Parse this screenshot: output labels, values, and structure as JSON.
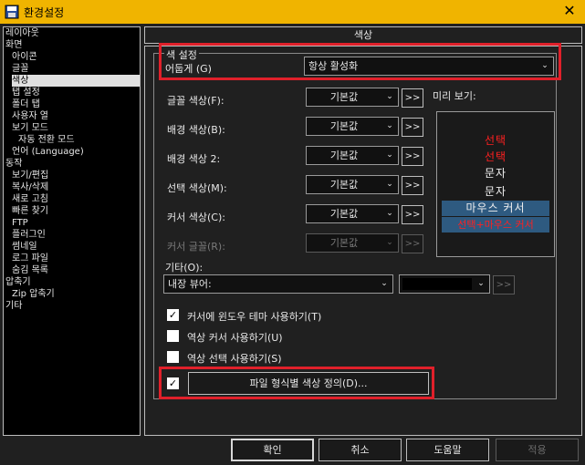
{
  "window": {
    "title": "환경설정",
    "close_glyph": "✕"
  },
  "tree": {
    "items": [
      "레이아웃",
      "화면",
      "아이콘",
      "글꼴",
      "색상",
      "탭 설정",
      "폴더 탭",
      "사용자 열",
      "보기 모드",
      "자동 전환 모드",
      "언어 (Language)",
      "동작",
      "보기/편집",
      "복사/삭제",
      "새로 고침",
      "빠른 찾기",
      "FTP",
      "플러그인",
      "썸네일",
      "로그 파일",
      "숨김 목록",
      "압축기",
      "Zip 압축기",
      "기타"
    ],
    "selected_index": 4
  },
  "section": {
    "header": "색상",
    "group_label": "색 설정",
    "dark_mode": {
      "label": "어둡게 (G)",
      "value": "항상 활성화"
    },
    "colors": [
      {
        "label": "글꼴 색상(F):",
        "value": "기본값",
        "more": ">>"
      },
      {
        "label": "배경 색상(B):",
        "value": "기본값",
        "more": ">>"
      },
      {
        "label": "배경 색상 2:",
        "value": "기본값",
        "more": ">>"
      },
      {
        "label": "선택 색상(M):",
        "value": "기본값",
        "more": ">>"
      },
      {
        "label": "커서 색상(C):",
        "value": "기본값",
        "more": ">>"
      },
      {
        "label": "커서 글꼴(R):",
        "value": "기본값",
        "more": ">>"
      }
    ],
    "preview": {
      "label": "미리 보기:",
      "rows": [
        "선택",
        "선택",
        "문자",
        "문자",
        "마우스 커서",
        "선택+마우스 커서"
      ]
    },
    "other": {
      "label": "기타(O):",
      "value": "내장 뷰어:",
      "more": ">>"
    },
    "checkboxes": [
      {
        "label": "커서에 윈도우 테마 사용하기(T)",
        "checked": true
      },
      {
        "label": "역상 커서 사용하기(U)",
        "checked": false
      },
      {
        "label": "역상 선택 사용하기(S)",
        "checked": false
      }
    ],
    "assoc": {
      "checked": true,
      "button_label": "파일 형식별 색상 정의(D)..."
    }
  },
  "buttons": {
    "ok": "확인",
    "cancel": "취소",
    "help": "도움말",
    "apply": "적용"
  },
  "colors": {
    "title_bar": "#f0b400",
    "highlight": "#e0202a",
    "preview_red": "#ff2020",
    "cursor_bg": "#2e5a80"
  }
}
